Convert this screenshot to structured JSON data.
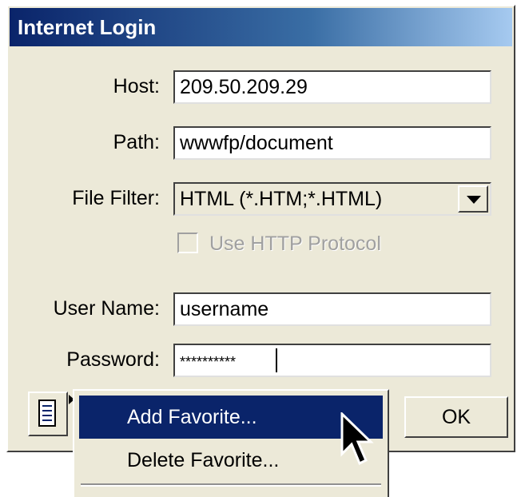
{
  "window": {
    "title": "Internet Login"
  },
  "form": {
    "host": {
      "label": "Host:",
      "value": "209.50.209.29"
    },
    "path": {
      "label": "Path:",
      "value": "wwwfp/document"
    },
    "file_filter": {
      "label": "File Filter:",
      "value": "HTML (*.HTM;*.HTML)"
    },
    "use_http": {
      "label": "Use HTTP Protocol",
      "checked": false,
      "enabled": false
    },
    "user_name": {
      "label": "User Name:",
      "value": "username"
    },
    "password": {
      "label": "Password:",
      "value": "**********"
    }
  },
  "buttons": {
    "ok": "OK"
  },
  "favorites_menu": {
    "items": [
      "Add Favorite...",
      "Delete Favorite..."
    ],
    "highlighted_index": 0
  },
  "icons": [
    "favorites-icon",
    "dropdown-arrow-icon",
    "mouse-pointer-icon"
  ],
  "colors": {
    "title_bar": "#0a246a",
    "menu_highlight": "#0a246a",
    "dialog_bg": "#ece9d8"
  }
}
